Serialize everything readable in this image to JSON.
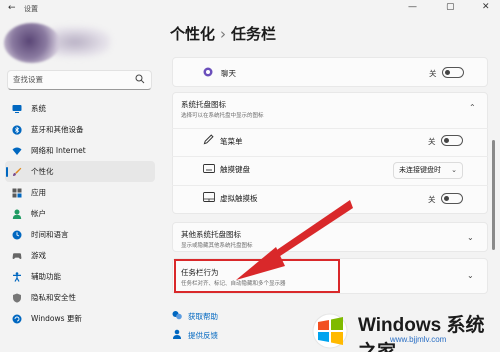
{
  "window": {
    "back_glyph": "←",
    "app_title": "设置",
    "minimize": "—",
    "maximize": "▢",
    "close": "✕"
  },
  "sidebar": {
    "search_placeholder": "查找设置",
    "items": [
      {
        "label": "系统",
        "icon": "monitor-icon",
        "color": "#0067c0",
        "active": false
      },
      {
        "label": "蓝牙和其他设备",
        "icon": "bluetooth-icon",
        "color": "#0067c0",
        "active": false
      },
      {
        "label": "网络和 Internet",
        "icon": "wifi-icon",
        "color": "#0067c0",
        "active": false
      },
      {
        "label": "个性化",
        "icon": "brush-icon",
        "color": "#e08a1e",
        "active": true
      },
      {
        "label": "应用",
        "icon": "apps-icon",
        "color": "#0067c0",
        "active": false
      },
      {
        "label": "帐户",
        "icon": "person-icon",
        "color": "#1f9b63",
        "active": false
      },
      {
        "label": "时间和语言",
        "icon": "globe-clock-icon",
        "color": "#0067c0",
        "active": false
      },
      {
        "label": "游戏",
        "icon": "gamepad-icon",
        "color": "#666666",
        "active": false
      },
      {
        "label": "辅助功能",
        "icon": "accessibility-icon",
        "color": "#0067c0",
        "active": false
      },
      {
        "label": "隐私和安全性",
        "icon": "shield-icon",
        "color": "#666666",
        "active": false
      },
      {
        "label": "Windows 更新",
        "icon": "update-icon",
        "color": "#0067c0",
        "active": false
      }
    ]
  },
  "breadcrumb": {
    "parent": "个性化",
    "separator": "›",
    "current": "任务栏"
  },
  "chat_row": {
    "label": "聊天",
    "toggle_text": "关",
    "toggle_on": false
  },
  "tray_icons": {
    "title": "系统托盘图标",
    "subtitle": "选择可以在系统托盘中显示的图标",
    "expanded": true,
    "items": [
      {
        "label": "笔菜单",
        "icon": "pen-icon",
        "control": "toggle",
        "value": "关",
        "on": false
      },
      {
        "label": "触摸键盘",
        "icon": "keyboard-icon",
        "control": "dropdown",
        "value": "未连接键盘时"
      },
      {
        "label": "虚拟触摸板",
        "icon": "touchpad-icon",
        "control": "toggle",
        "value": "关",
        "on": false
      }
    ]
  },
  "other_tray": {
    "title": "其他系统托盘图标",
    "subtitle": "显示或隐藏其他系统托盘图标"
  },
  "behaviors": {
    "title": "任务栏行为",
    "subtitle": "任务栏对齐、标记、自动隐藏和多个显示器"
  },
  "links": [
    {
      "label": "获取帮助",
      "icon": "help-icon"
    },
    {
      "label": "提供反馈",
      "icon": "feedback-icon"
    }
  ],
  "annotation": {
    "highlight_color": "#d9282a",
    "arrow_color": "#d9282a"
  },
  "watermark": {
    "title": "Windows 系统之家",
    "site": "www.bjjmlv.com"
  }
}
